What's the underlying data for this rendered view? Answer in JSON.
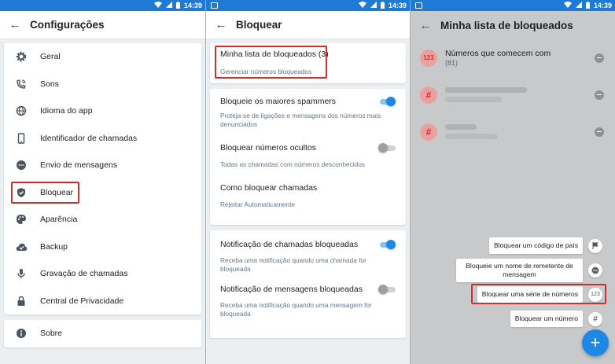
{
  "status": {
    "time": "14:39"
  },
  "settings": {
    "title": "Configurações",
    "items": [
      {
        "label": "Geral",
        "icon": "gear-icon"
      },
      {
        "label": "Sons",
        "icon": "phone-ring-icon"
      },
      {
        "label": "Idioma do app",
        "icon": "globe-icon"
      },
      {
        "label": "Identificador de chamadas",
        "icon": "smartphone-icon"
      },
      {
        "label": "Envio de mensagens",
        "icon": "chat-icon"
      },
      {
        "label": "Bloquear",
        "icon": "shield-icon"
      },
      {
        "label": "Aparência",
        "icon": "palette-icon"
      },
      {
        "label": "Backup",
        "icon": "cloud-icon"
      },
      {
        "label": "Gravação de chamadas",
        "icon": "mic-icon"
      },
      {
        "label": "Central de Privacidade",
        "icon": "lock-icon"
      }
    ],
    "about": {
      "label": "Sobre",
      "icon": "info-icon"
    }
  },
  "block": {
    "title": "Bloquear",
    "my_list": {
      "title": "Minha lista de bloqueados (3)",
      "sub": "Gerenciar números bloqueados"
    },
    "spammers": {
      "title": "Bloqueie os maiores spammers",
      "sub": "Proteja-se de ligações e mensagens dos números mais denunciados",
      "on": true
    },
    "hidden": {
      "title": "Bloquear números ocultos",
      "sub": "Todas as chamadas com números desconhecidos",
      "on": false
    },
    "how": {
      "title": "Como bloquear chamadas",
      "sub": "Rejeitar Automaticamente"
    },
    "notif_calls": {
      "title": "Notificação de chamadas bloqueadas",
      "sub": "Receba uma notificação quando uma chamada for bloqueada",
      "on": true
    },
    "notif_msgs": {
      "title": "Notificação de mensagens bloqueadas",
      "sub": "Receba uma notificação quando uma mensagem for bloqueada",
      "on": false
    }
  },
  "blocklist": {
    "title": "Minha lista de bloqueados",
    "entries": [
      {
        "avatar": "123",
        "name": "Números que comecem com",
        "count": "(81)"
      },
      {
        "avatar": "#",
        "name": "",
        "count": ""
      },
      {
        "avatar": "#",
        "name": "",
        "count": ""
      }
    ],
    "actions": [
      {
        "label": "Bloquear um código de país",
        "icon": "flag-icon"
      },
      {
        "label": "Bloqueie um nome de remetente de mensagem",
        "icon": "chat-icon"
      },
      {
        "label": "Bloquear uma série de números",
        "icon": "123-icon",
        "badge": "123"
      },
      {
        "label": "Bloquear um número",
        "icon": "hash-icon",
        "badge": "#"
      }
    ],
    "fab": "+"
  },
  "colors": {
    "accent": "#1e88e5",
    "highlight": "#d32f2f",
    "statusbar": "#1f7ad6"
  }
}
